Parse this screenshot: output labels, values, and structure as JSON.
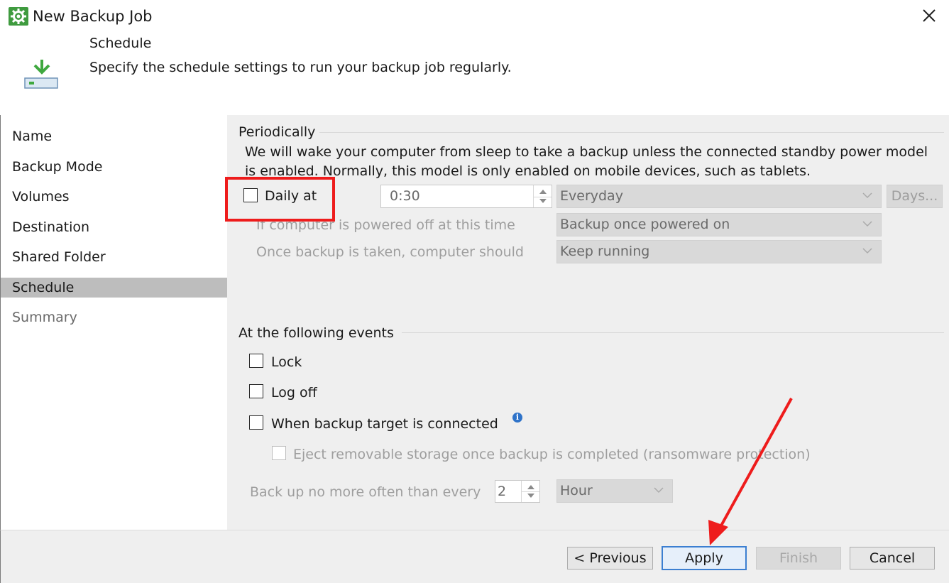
{
  "window": {
    "title": "New Backup Job",
    "icon": "gear-icon",
    "close_icon": "close-icon"
  },
  "header": {
    "title": "Schedule",
    "description": "Specify the schedule settings to run your backup job regularly.",
    "icon": "backup-download-icon"
  },
  "nav": {
    "items": [
      {
        "label": "Name"
      },
      {
        "label": "Backup Mode"
      },
      {
        "label": "Volumes"
      },
      {
        "label": "Destination"
      },
      {
        "label": "Shared Folder"
      },
      {
        "label": "Schedule",
        "active": true
      },
      {
        "label": "Summary",
        "disabled": true
      }
    ]
  },
  "periodically": {
    "group_label": "Periodically",
    "info_line1": "We will wake your computer from sleep to take a backup unless the connected standby power model",
    "info_line2": "is enabled. Normally, this model is only enabled on mobile devices, such as tablets.",
    "daily_label": "Daily at",
    "daily_checked": false,
    "time_value": "0:30",
    "frequency_value": "Everyday",
    "days_button": "Days...",
    "powered_off_label": "If computer is powered off at this time",
    "powered_off_value": "Backup once powered on",
    "after_backup_label": "Once backup is taken, computer should",
    "after_backup_value": "Keep running"
  },
  "events": {
    "group_label": "At the following events",
    "lock_label": "Lock",
    "logoff_label": "Log off",
    "target_label": "When backup target is connected",
    "eject_label": "Eject removable storage once backup is completed (ransomware protection)",
    "backup_often_label": "Back up no more often than every",
    "interval_value": "2",
    "interval_unit": "Hour",
    "info_icon": "info-icon"
  },
  "footer": {
    "previous": "< Previous",
    "apply": "Apply",
    "finish": "Finish",
    "cancel": "Cancel"
  },
  "colors": {
    "highlight_box": "#ee1c1c",
    "annotation_arrow": "#ee1c1c",
    "accent": "#3c7fd1",
    "active_nav": "#bdbdbd"
  }
}
